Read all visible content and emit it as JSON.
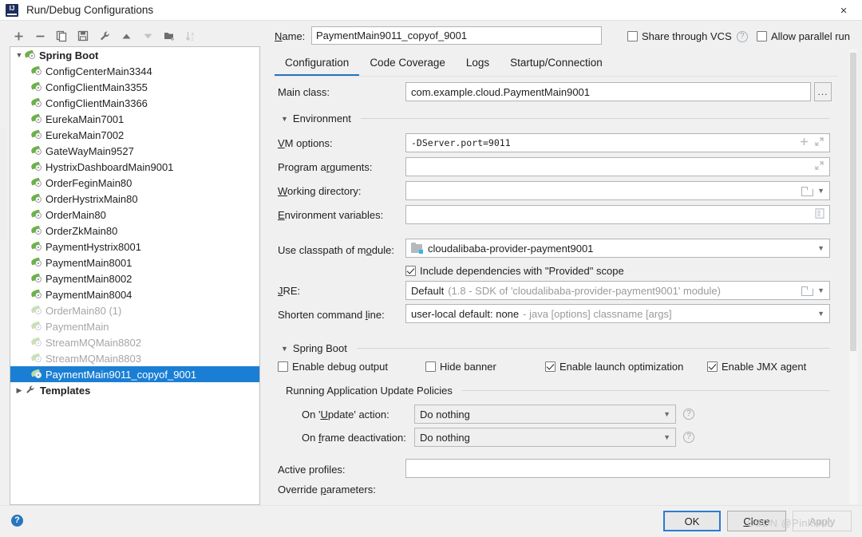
{
  "window": {
    "title": "Run/Debug Configurations",
    "app_icon": "intellij-idea-logo-icon",
    "close_icon": "×"
  },
  "toolbar": {
    "buttons": [
      {
        "name": "add-configuration-button",
        "icon": "plus-icon"
      },
      {
        "name": "remove-configuration-button",
        "icon": "minus-icon"
      },
      {
        "name": "copy-configuration-button",
        "icon": "copy-icon"
      },
      {
        "name": "save-configuration-button",
        "icon": "save-icon"
      },
      {
        "name": "edit-templates-button",
        "icon": "wrench-icon"
      },
      {
        "name": "move-up-button",
        "icon": "arrow-up-icon"
      },
      {
        "name": "move-down-button",
        "icon": "arrow-down-icon"
      },
      {
        "name": "new-folder-button",
        "icon": "folder-add-icon"
      },
      {
        "name": "sort-button",
        "icon": "sort-alpha-icon"
      }
    ]
  },
  "tree": {
    "root": {
      "label": "Spring Boot",
      "expanded": true,
      "icon": "spring-boot-icon"
    },
    "items": [
      {
        "label": "ConfigCenterMain3344",
        "dim": false
      },
      {
        "label": "ConfigClientMain3355",
        "dim": false
      },
      {
        "label": "ConfigClientMain3366",
        "dim": false
      },
      {
        "label": "EurekaMain7001",
        "dim": false
      },
      {
        "label": "EurekaMain7002",
        "dim": false
      },
      {
        "label": "GateWayMain9527",
        "dim": false
      },
      {
        "label": "HystrixDashboardMain9001",
        "dim": false
      },
      {
        "label": "OrderFeginMain80",
        "dim": false
      },
      {
        "label": "OrderHystrixMain80",
        "dim": false
      },
      {
        "label": "OrderMain80",
        "dim": false
      },
      {
        "label": "OrderZkMain80",
        "dim": false
      },
      {
        "label": "PaymentHystrix8001",
        "dim": false
      },
      {
        "label": "PaymentMain8001",
        "dim": false
      },
      {
        "label": "PaymentMain8002",
        "dim": false
      },
      {
        "label": "PaymentMain8004",
        "dim": false
      },
      {
        "label": "OrderMain80 (1)",
        "dim": true
      },
      {
        "label": "PaymentMain",
        "dim": true
      },
      {
        "label": "StreamMQMain8802",
        "dim": true
      },
      {
        "label": "StreamMQMain8803",
        "dim": true
      },
      {
        "label": "PaymentMain9011_copyof_9001",
        "dim": true,
        "selected": true
      }
    ],
    "templates": {
      "label": "Templates",
      "expanded": false,
      "icon": "wrench-icon"
    }
  },
  "header": {
    "name_label": "Name:",
    "name_value": "PaymentMain9011_copyof_9001",
    "share_vcs_label": "Share through VCS",
    "share_vcs_checked": false,
    "allow_parallel_label": "Allow parallel run",
    "allow_parallel_checked": false
  },
  "tabs": [
    {
      "label": "Configuration",
      "active": true
    },
    {
      "label": "Code Coverage",
      "active": false
    },
    {
      "label": "Logs",
      "active": false
    },
    {
      "label": "Startup/Connection",
      "active": false
    }
  ],
  "form": {
    "main_class_label": "Main class:",
    "main_class_value": "com.example.cloud.PaymentMain9001",
    "main_class_browse": "...",
    "environment_section": "Environment",
    "vm_options_label": "VM options:",
    "vm_options_value": "-DServer.port=9011",
    "program_arguments_label": "Program arguments:",
    "program_arguments_value": "",
    "working_directory_label": "Working directory:",
    "working_directory_value": "",
    "environment_variables_label": "Environment variables:",
    "environment_variables_value": "",
    "use_classpath_label": "Use classpath of module:",
    "use_classpath_value": "cloudalibaba-provider-payment9001",
    "include_dependencies_label": "Include dependencies with \"Provided\" scope",
    "include_dependencies_checked": true,
    "jre_label": "JRE:",
    "jre_value": "Default",
    "jre_value_suffix": "(1.8 - SDK of 'cloudalibaba-provider-payment9001' module)",
    "shorten_label": "Shorten command line:",
    "shorten_value": "user-local default: none",
    "shorten_value_suffix": "- java [options] classname [args]"
  },
  "spring_boot": {
    "section_label": "Spring Boot",
    "checkboxes": [
      {
        "label": "Enable debug output",
        "checked": false
      },
      {
        "label": "Hide banner",
        "checked": false
      },
      {
        "label": "Enable launch optimization",
        "checked": true
      },
      {
        "label": "Enable JMX agent",
        "checked": true
      }
    ],
    "update_policies_label": "Running Application Update Policies",
    "on_update_label": "On 'Update' action:",
    "on_update_value": "Do nothing",
    "on_frame_label": "On frame deactivation:",
    "on_frame_value": "Do nothing",
    "active_profiles_label": "Active profiles:",
    "active_profiles_value": "",
    "override_parameters_label": "Override parameters:"
  },
  "footer": {
    "help_icon": "?",
    "ok_label": "OK",
    "close_label": "Close",
    "apply_label": "Apply",
    "apply_disabled": true,
    "watermark": "CSDN @PinkHub"
  },
  "colors": {
    "accent": "#2675bf",
    "selection": "#1a7fd4",
    "spring_green": "#6cb33f"
  }
}
